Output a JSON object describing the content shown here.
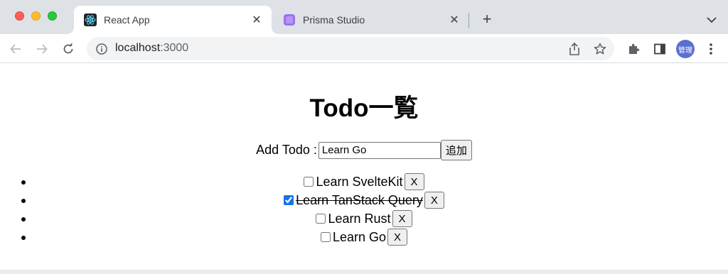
{
  "browser": {
    "tabs": [
      {
        "title": "React App",
        "favicon": "react-logo-icon",
        "active": true
      },
      {
        "title": "Prisma Studio",
        "favicon": "prisma-logo-icon",
        "active": false
      }
    ],
    "new_tab_symbol": "+",
    "close_symbol": "✕",
    "address": {
      "host": "localhost",
      "port": ":3000"
    },
    "profile_label": "管理"
  },
  "page": {
    "title": "Todo一覧",
    "add_form": {
      "label": "Add Todo :",
      "input_value": "Learn Go",
      "submit_label": "追加"
    },
    "todos": [
      {
        "text": "Learn SvelteKit",
        "completed": false,
        "delete_label": "X"
      },
      {
        "text": "Learn TanStack Query",
        "completed": true,
        "delete_label": "X"
      },
      {
        "text": "Learn Rust",
        "completed": false,
        "delete_label": "X"
      },
      {
        "text": "Learn Go",
        "completed": false,
        "delete_label": "X"
      }
    ]
  },
  "colors": {
    "tabstrip": "#dee1e6",
    "omnibox": "#f1f3f4",
    "avatar": "#5b6fd1",
    "checkbox_accent": "#1a73e8"
  }
}
